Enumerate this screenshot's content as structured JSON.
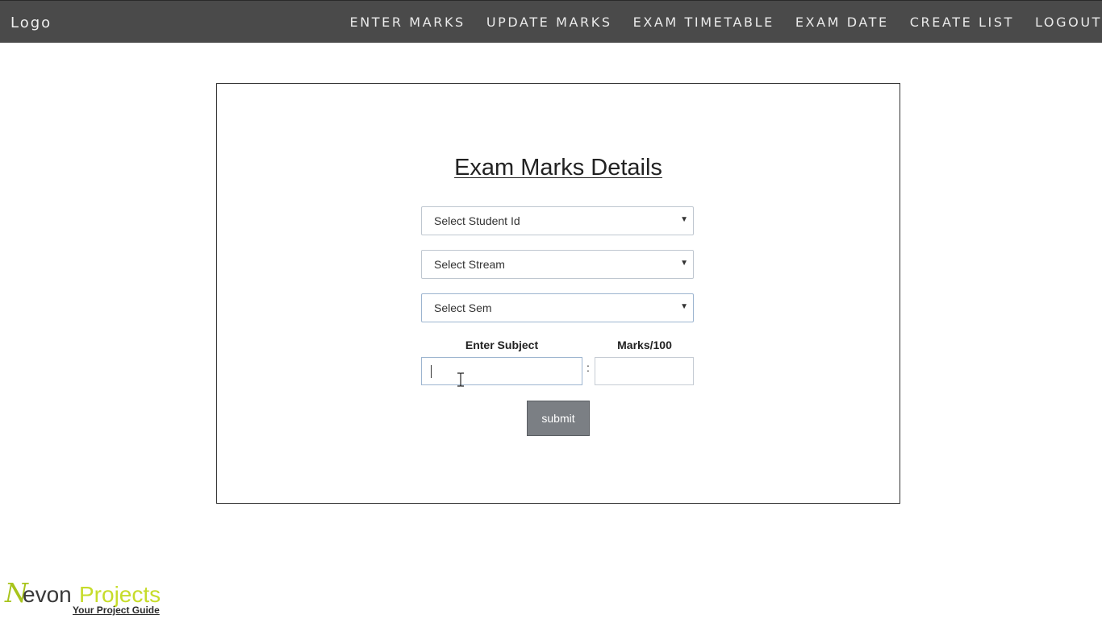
{
  "navbar": {
    "logo": "Logo",
    "links": [
      "ENTER MARKS",
      "UPDATE MARKS",
      "EXAM TIMETABLE",
      "EXAM DATE",
      "CREATE LIST",
      "LOGOUT"
    ]
  },
  "form": {
    "title": "Exam Marks Details",
    "selects": {
      "student_id": "Select Student Id",
      "stream": "Select Stream",
      "sem": "Select Sem"
    },
    "subject_label": "Enter Subject",
    "marks_label": "Marks/100",
    "separator": ":",
    "subject_value": "",
    "marks_value": "",
    "submit_label": "submit"
  },
  "brand": {
    "initial": "N",
    "name_part1": "evon",
    "name_part2": "Projects",
    "tagline": "Your Project Guide"
  },
  "colors": {
    "navbar_bg": "#4a4a4a",
    "submit_bg": "#7b7f84",
    "brand_accent": "#c6dc2a"
  }
}
